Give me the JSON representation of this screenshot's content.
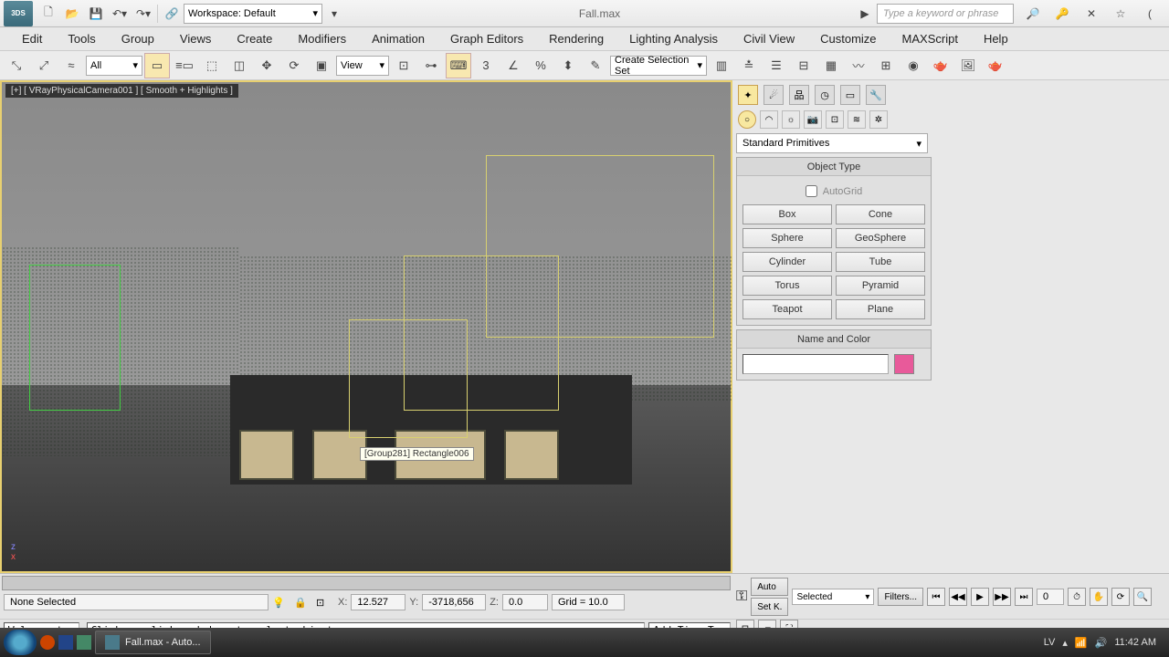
{
  "titlebar": {
    "app_abbrev": "3DS",
    "workspace_label": "Workspace: Default",
    "document_title": "Fall.max",
    "search_placeholder": "Type a keyword or phrase"
  },
  "menu": {
    "items": [
      "Edit",
      "Tools",
      "Group",
      "Views",
      "Create",
      "Modifiers",
      "Animation",
      "Graph Editors",
      "Rendering",
      "Lighting Analysis",
      "Civil View",
      "Customize",
      "MAXScript",
      "Help"
    ]
  },
  "toolbar": {
    "filter_value": "All",
    "view_value": "View",
    "selection_set_value": "Create Selection Set",
    "coord_letter": "3"
  },
  "viewport": {
    "label": "[+] [ VRayPhysicalCamera001 ] [ Smooth + Highlights ]",
    "tooltip": "[Group281] Rectangle006",
    "axis_z": "z",
    "axis_x": "x"
  },
  "panel": {
    "category": "Standard Primitives",
    "rollups": {
      "object_type": "Object Type",
      "autogrid": "AutoGrid",
      "name_color": "Name and Color"
    },
    "primitives": [
      [
        "Box",
        "Cone"
      ],
      [
        "Sphere",
        "GeoSphere"
      ],
      [
        "Cylinder",
        "Tube"
      ],
      [
        "Torus",
        "Pyramid"
      ],
      [
        "Teapot",
        "Plane"
      ]
    ]
  },
  "status": {
    "selection": "None Selected",
    "x_label": "X:",
    "x_val": "12.527",
    "y_label": "Y:",
    "y_val": "-3718,656",
    "z_label": "Z:",
    "z_val": "0.0",
    "grid": "Grid = 10.0",
    "welcome": "Welcome tc",
    "prompt": "Click or click-and-drag to select objects",
    "add_time_tag": "Add Time Tag",
    "auto": "Auto",
    "setkey": "Set K.",
    "selected": "Selected",
    "filters": "Filters...",
    "frame": "0",
    "key_icon_label": "🔑"
  },
  "taskbar": {
    "app_task": "Fall.max - Auto...",
    "lang": "LV",
    "clock": "11:42 AM"
  }
}
